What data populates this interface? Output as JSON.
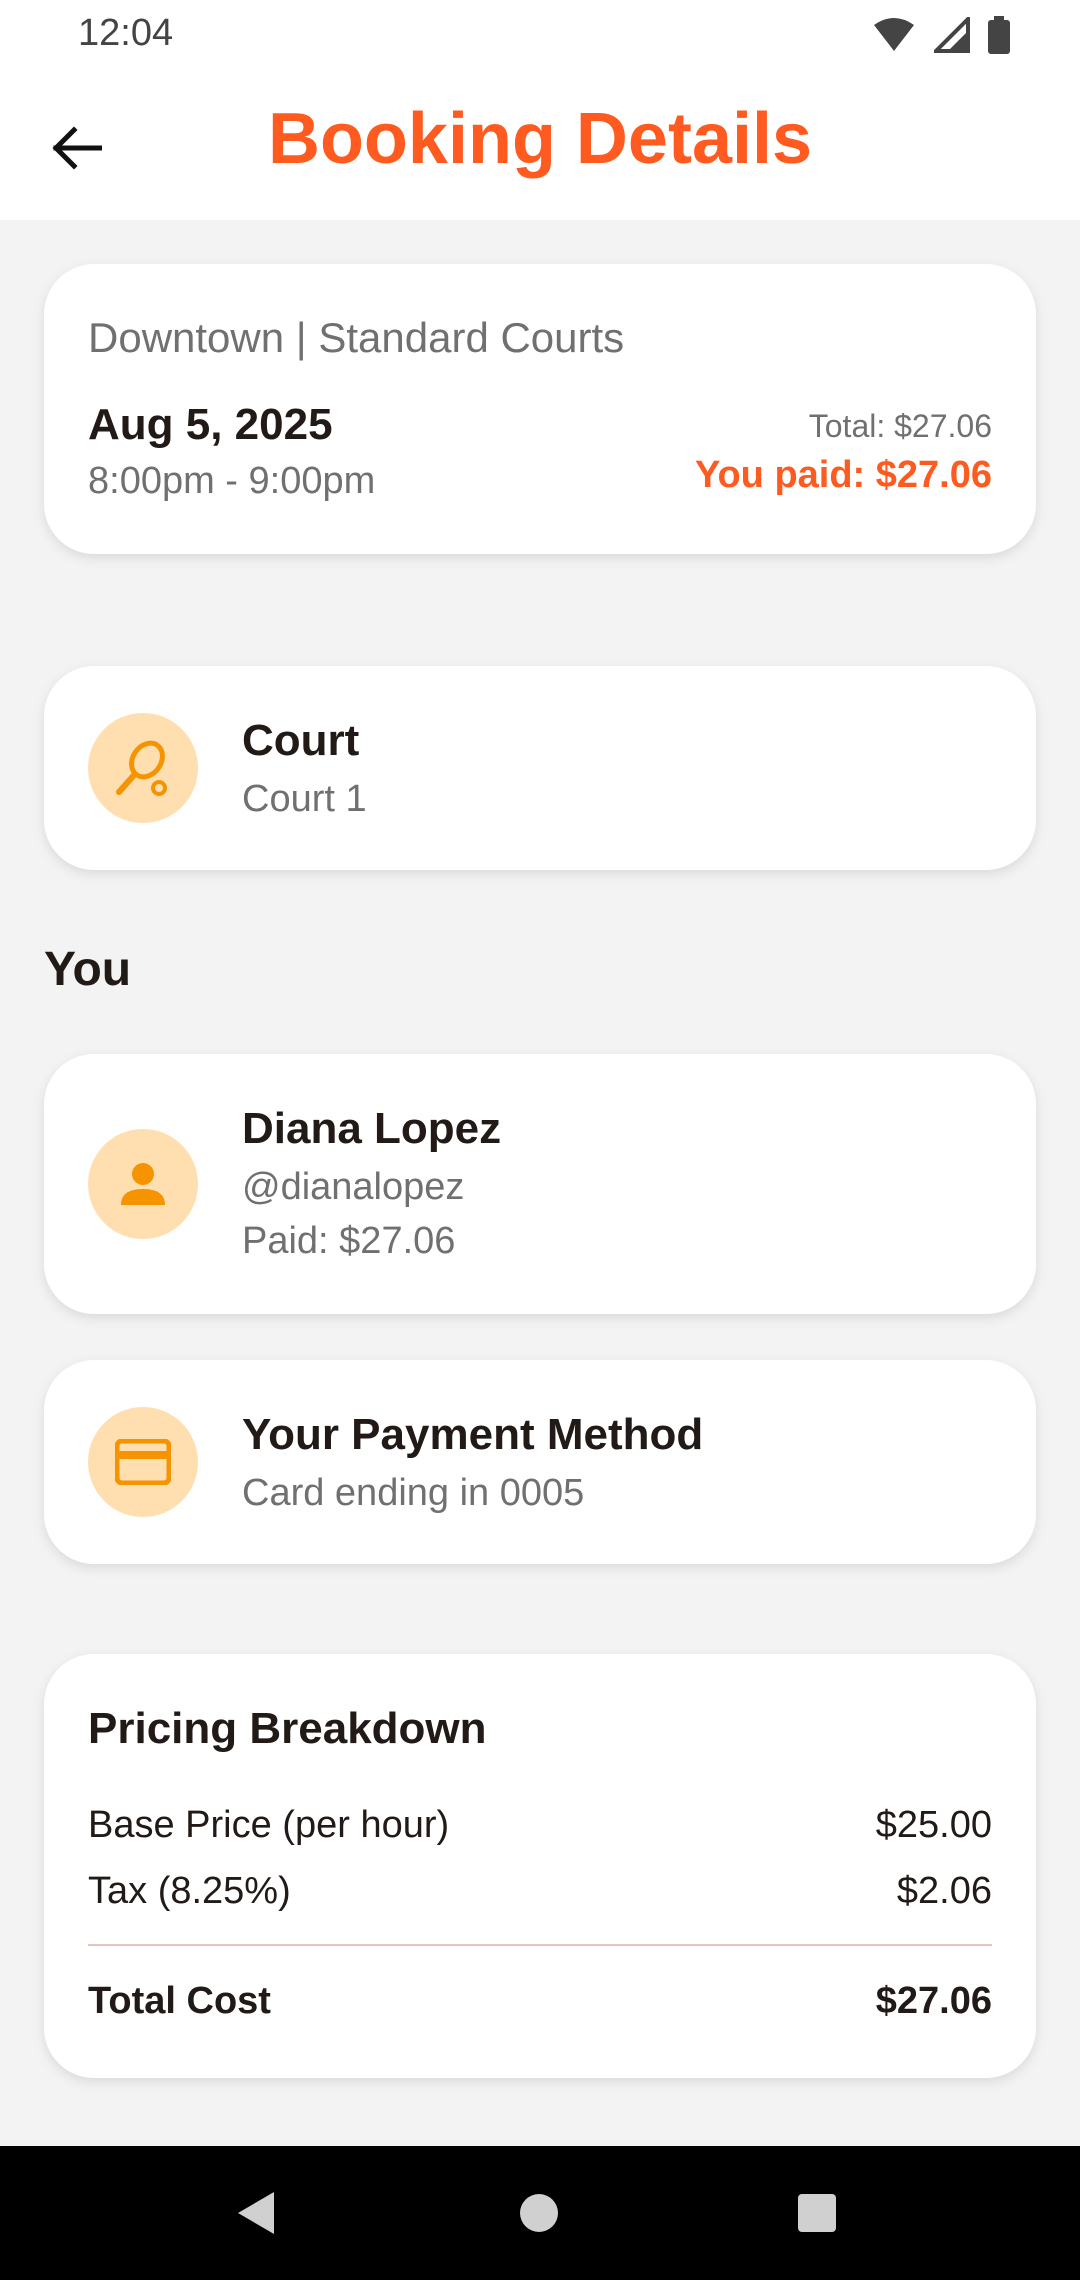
{
  "status_bar": {
    "time": "12:04"
  },
  "header": {
    "title": "Booking Details"
  },
  "booking": {
    "location": "Downtown | Standard Courts",
    "date": "Aug 5, 2025",
    "time_range": "8:00pm - 9:00pm",
    "total": "Total: $27.06",
    "you_paid": "You paid: $27.06"
  },
  "court": {
    "title": "Court",
    "name": "Court 1"
  },
  "you_section": {
    "label": "You"
  },
  "user": {
    "name": "Diana Lopez",
    "handle": "@dianalopez",
    "paid": "Paid: $27.06"
  },
  "payment": {
    "title": "Your Payment Method",
    "detail": "Card ending in 0005"
  },
  "pricing": {
    "title": "Pricing Breakdown",
    "rows": [
      {
        "label": "Base Price (per hour)",
        "value": "$25.00"
      },
      {
        "label": "Tax (8.25%)",
        "value": "$2.06"
      }
    ],
    "total_label": "Total Cost",
    "total_value": "$27.06"
  },
  "colors": {
    "accent": "#ff5a1f",
    "icon_bg": "#ffdfb0",
    "icon_fg": "#f59300"
  }
}
